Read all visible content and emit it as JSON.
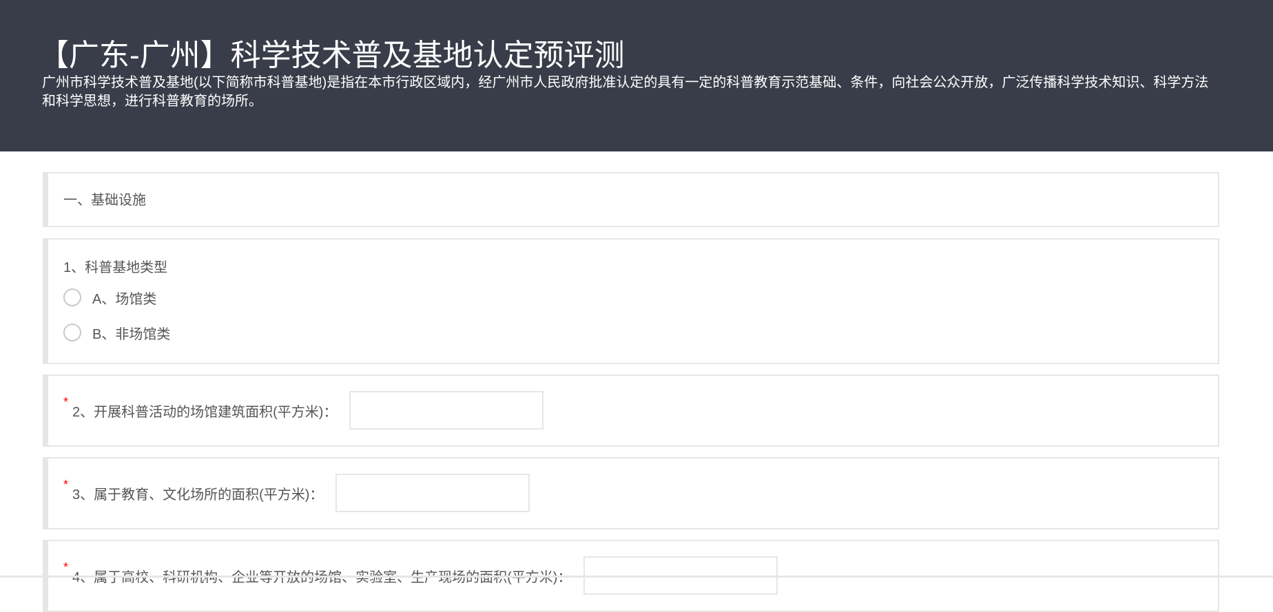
{
  "header": {
    "title": "【广东-广州】科学技术普及基地认定预评测",
    "description": "广州市科学技术普及基地(以下简称市科普基地)是指在本市行政区域内，经广州市人民政府批准认定的具有一定的科普教育示范基础、条件，向社会公众开放，广泛传播科学技术知识、科学方法和科学思想，进行科普教育的场所。"
  },
  "colors": {
    "header_bg": "#393d49",
    "required_star": "#ff0000",
    "border": "#e6e6e6"
  },
  "section1": {
    "title": "一、基础设施"
  },
  "q1": {
    "title": "1、科普基地类型",
    "options": [
      {
        "label": "A、场馆类",
        "selected": false
      },
      {
        "label": "B、非场馆类",
        "selected": false
      }
    ]
  },
  "q2": {
    "required_mark": "*",
    "label": "2、开展科普活动的场馆建筑面积(平方米)：",
    "value": ""
  },
  "q3": {
    "required_mark": "*",
    "label": "3、属于教育、文化场所的面积(平方米)：",
    "value": ""
  },
  "q4": {
    "required_mark": "*",
    "label": "4、属于高校、科研机构、企业等开放的场馆、实验室、生产现场的面积(平方米)：",
    "value": ""
  }
}
